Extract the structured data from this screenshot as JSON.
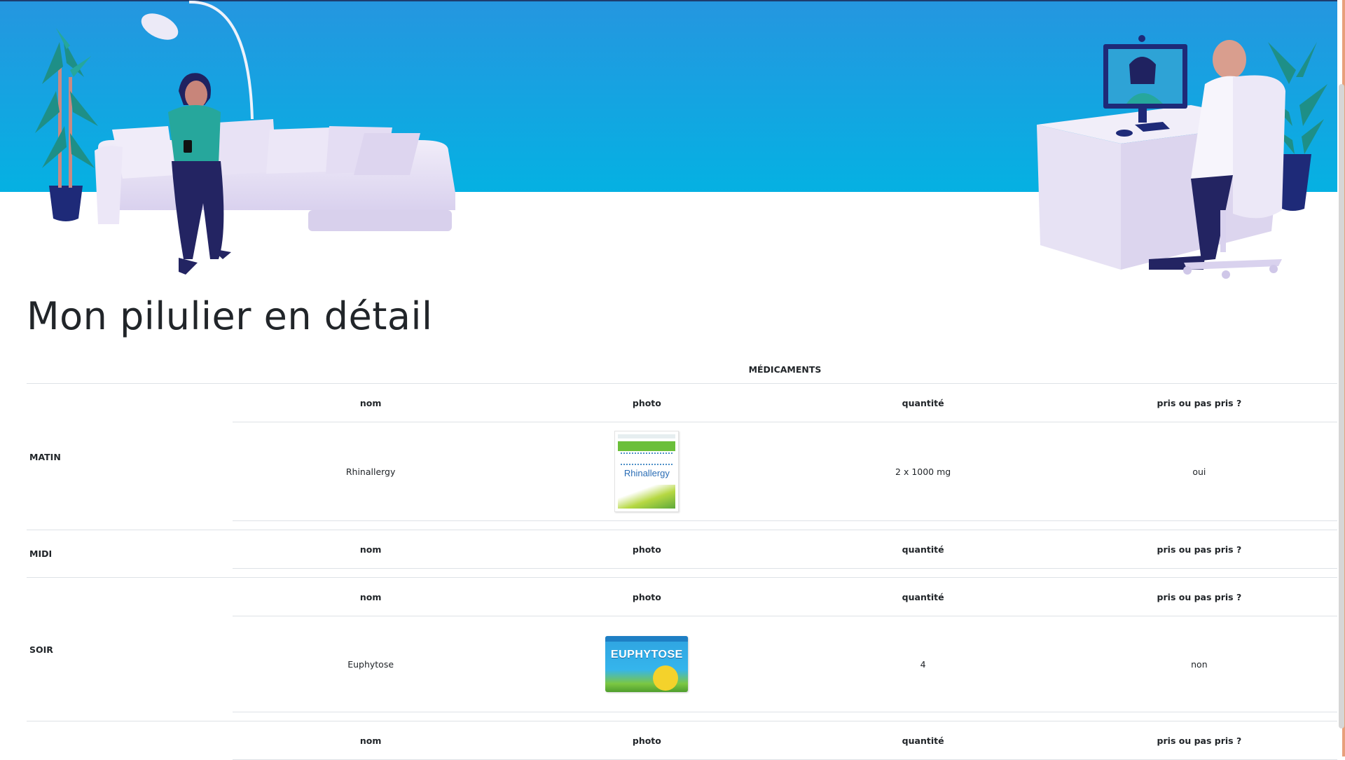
{
  "page": {
    "title": "Mon pilulier en détail"
  },
  "table": {
    "group_header": "MÉDICAMENTS",
    "columns": [
      "nom",
      "photo",
      "quantité",
      "pris ou pas pris ?"
    ],
    "periods": [
      {
        "label": "MATIN",
        "rows": [
          {
            "nom": "Rhinallergy",
            "photo_brand": "Rhinallergy",
            "quantite": "2 x 1000 mg",
            "pris": "oui"
          }
        ]
      },
      {
        "label": "MIDI",
        "rows": []
      },
      {
        "label": "SOIR",
        "rows": [
          {
            "nom": "Euphytose",
            "photo_brand": "EUPHYTOSE",
            "quantite": "4",
            "pris": "non"
          }
        ]
      }
    ]
  },
  "colors": {
    "sky": "#0aaee0",
    "sky_top": "#2596e0",
    "sofa": "#e6e0f3",
    "accent": "#e8a07c"
  }
}
